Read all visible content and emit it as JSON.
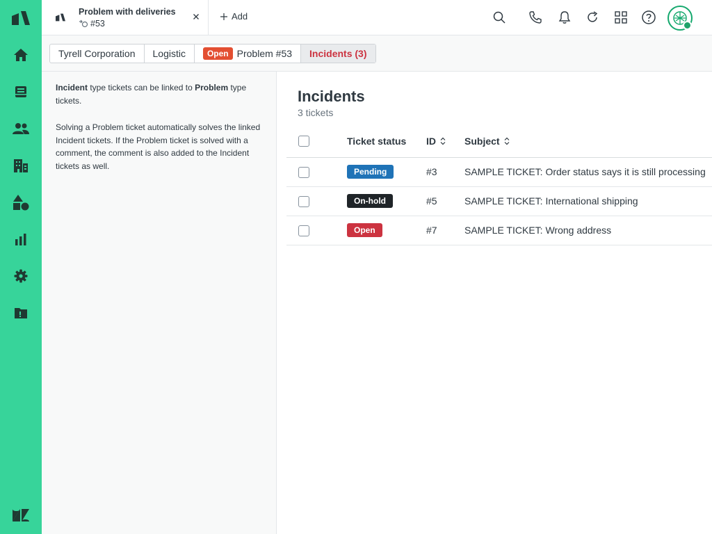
{
  "tab": {
    "title": "Problem with deliveries",
    "ticket_ref": "#53"
  },
  "toolbar": {
    "add_label": "Add"
  },
  "breadcrumbs": [
    {
      "label": "Tyrell Corporation"
    },
    {
      "label": "Logistic"
    },
    {
      "badge": "Open",
      "label": "Problem #53"
    },
    {
      "label": "Incidents (3)"
    }
  ],
  "info": {
    "p1_bold1": "Incident",
    "p1_text1": " type tickets can be linked to ",
    "p1_bold2": "Problem",
    "p1_text2": " type tickets.",
    "p2": "Solving a Problem ticket automatically solves the linked Incident tickets. If the Problem ticket is solved with a comment, the comment is also added to the Incident tickets as well."
  },
  "main": {
    "title": "Incidents",
    "count": "3 tickets",
    "columns": {
      "status": "Ticket status",
      "id": "ID",
      "subject": "Subject"
    },
    "rows": [
      {
        "status": "Pending",
        "status_color": "#1f73b7",
        "id": "#3",
        "subject": "SAMPLE TICKET: Order status says it is still processing"
      },
      {
        "status": "On-hold",
        "status_color": "#1f2428",
        "id": "#5",
        "subject": "SAMPLE TICKET: International shipping"
      },
      {
        "status": "Open",
        "status_color": "#cc3340",
        "id": "#7",
        "subject": "SAMPLE TICKET: Wrong address"
      }
    ]
  },
  "colors": {
    "rail": "#37d49a",
    "accent_red": "#cc3340",
    "open_badge": "#e34f32"
  },
  "icons": [
    "zendesk-logo-icon",
    "home-icon",
    "inbox-icon",
    "users-icon",
    "building-icon",
    "shapes-icon",
    "bar-chart-icon",
    "gear-icon",
    "folder-icon",
    "search-icon",
    "phone-icon",
    "bell-icon",
    "refresh-icon",
    "apps-grid-icon",
    "help-icon"
  ]
}
